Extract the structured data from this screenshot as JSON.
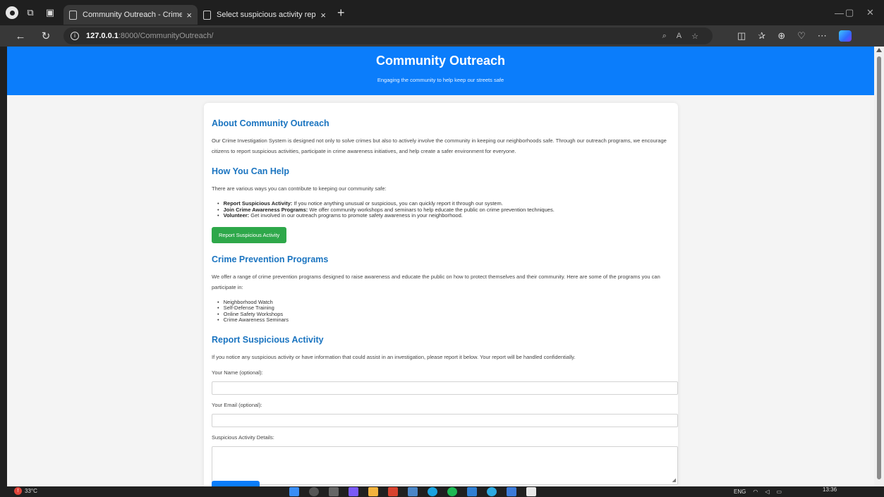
{
  "browser": {
    "tabs": [
      {
        "label": "Community Outreach - Crime Inv",
        "active": true
      },
      {
        "label": "Select suspicious activity report ti",
        "active": false
      }
    ],
    "url_host": "127.0.0.1",
    "url_path": ":8000/CommunityOutreach/",
    "new_tab_label": "+"
  },
  "hero": {
    "title": "Community Outreach",
    "subtitle": "Engaging the community to help keep our streets safe"
  },
  "about": {
    "heading": "About Community Outreach",
    "text": "Our Crime Investigation System is designed not only to solve crimes but also to actively involve the community in keeping our neighborhoods safe. Through our outreach programs, we encourage citizens to report suspicious activities, participate in crime awareness initiatives, and help create a safer environment for everyone."
  },
  "help": {
    "heading": "How You Can Help",
    "intro": "There are various ways you can contribute to keeping our community safe:",
    "items": [
      {
        "title": "Report Suspicious Activity:",
        "text": " If you notice anything unusual or suspicious, you can quickly report it through our system."
      },
      {
        "title": "Join Crime Awareness Programs:",
        "text": " We offer community workshops and seminars to help educate the public on crime prevention techniques."
      },
      {
        "title": "Volunteer:",
        "text": " Get involved in our outreach programs to promote safety awareness in your neighborhood."
      }
    ],
    "button_label": "Report Suspicious Activity"
  },
  "programs": {
    "heading": "Crime Prevention Programs",
    "text": "We offer a range of crime prevention programs designed to raise awareness and educate the public on how to protect themselves and their community. Here are some of the programs you can participate in:",
    "items": [
      "Neighborhood Watch",
      "Self-Defense Training",
      "Online Safety Workshops",
      "Crime Awareness Seminars"
    ]
  },
  "report": {
    "heading": "Report Suspicious Activity",
    "text": "If you notice any suspicious activity or have information that could assist in an investigation, please report it below. Your report will be handled confidentially.",
    "name_label": "Your Name (optional):",
    "email_label": "Your Email (optional):",
    "details_label": "Suspicious Activity Details:"
  },
  "taskbar": {
    "weather": "33°C",
    "lang": "ENG",
    "time": "13:36"
  },
  "colors": {
    "hero_blue": "#0b7dfb",
    "heading_blue": "#1a74c0",
    "button_green": "#2ea84a"
  }
}
